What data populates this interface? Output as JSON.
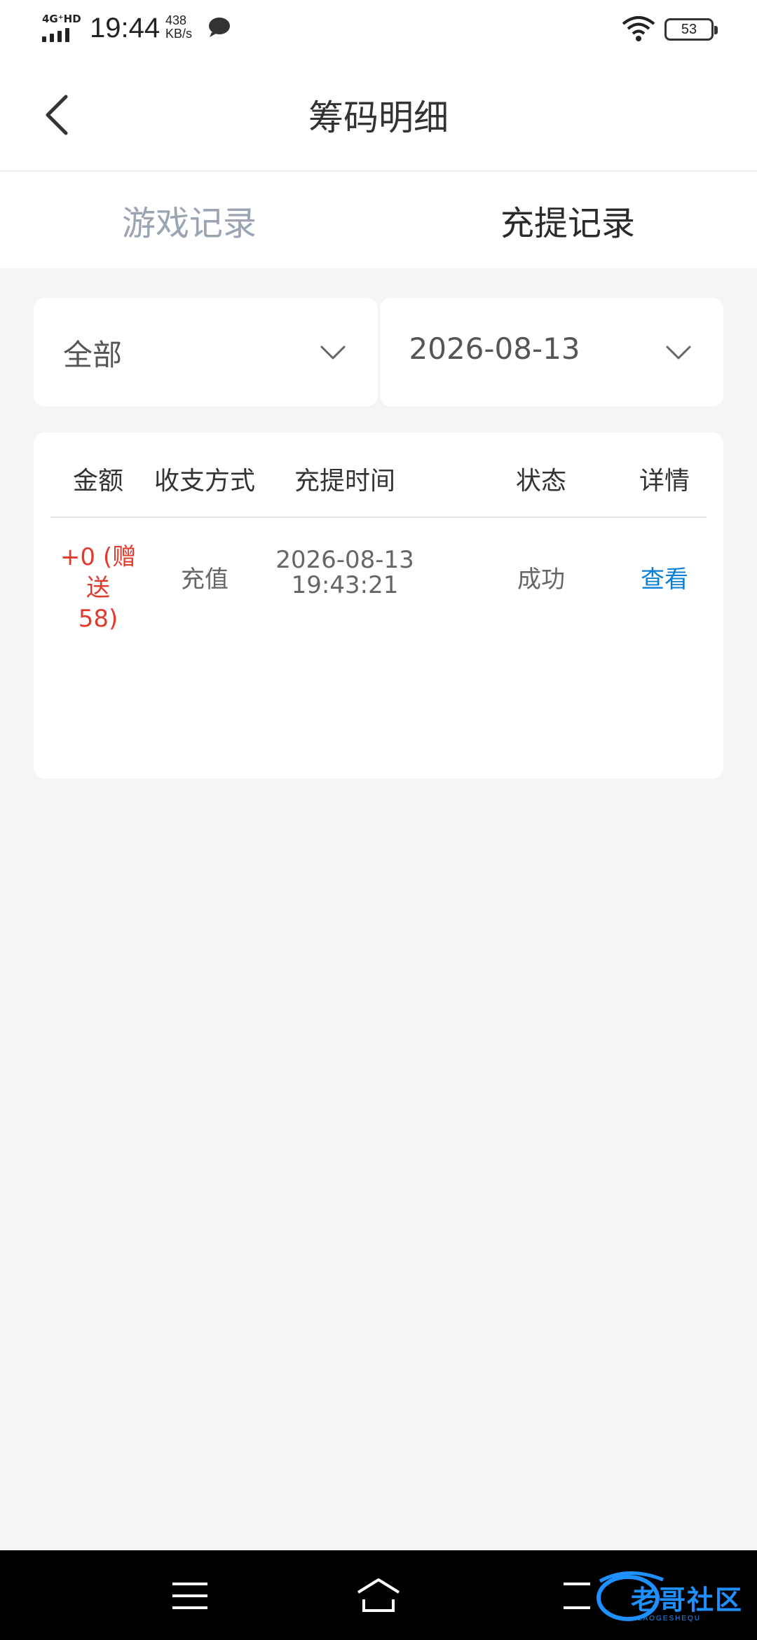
{
  "status_bar": {
    "network": "4G⁺HD",
    "time": "19:44",
    "speed_value": "438",
    "speed_unit": "KB/s",
    "battery": "53"
  },
  "header": {
    "title": "筹码明细"
  },
  "tabs": [
    {
      "label": "游戏记录",
      "active": false
    },
    {
      "label": "充提记录",
      "active": true
    }
  ],
  "filters": {
    "type_value": "全部",
    "date_value": "2026-08-13"
  },
  "table": {
    "headers": [
      "金额",
      "收支方式",
      "充提时间",
      "状态",
      "详情"
    ],
    "rows": [
      {
        "amount_line1": "+0 (赠送",
        "amount_line2": "58)",
        "method": "充值",
        "date": "2026-08-13",
        "time": "19:43:21",
        "status": "成功",
        "detail": "查看"
      }
    ]
  },
  "watermark": {
    "text": "老哥社区",
    "sub": "LAOGESHEQU"
  },
  "colors": {
    "amount_red": "#e23b2e",
    "link_blue": "#0a7fd6",
    "tab_inactive": "#9aa4b2"
  }
}
